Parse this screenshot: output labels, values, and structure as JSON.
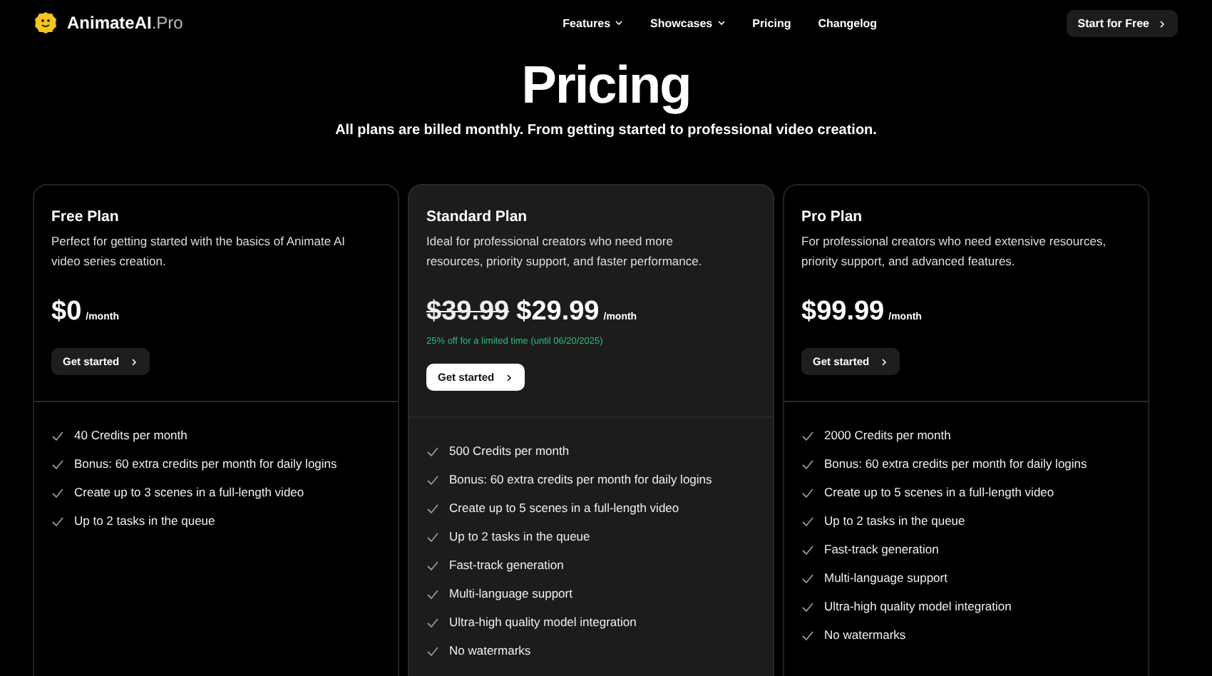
{
  "nav": {
    "logo": {
      "name": "AnimateAI",
      "suffix": ".Pro"
    },
    "links": [
      {
        "label": "Features",
        "dropdown": true
      },
      {
        "label": "Showcases",
        "dropdown": true
      },
      {
        "label": "Pricing",
        "dropdown": false
      },
      {
        "label": "Changelog",
        "dropdown": false
      }
    ],
    "cta": "Start for Free"
  },
  "heading": "Pricing",
  "subheading": "All plans are billed monthly. From getting started to professional video creation.",
  "plans": [
    {
      "name": "Free Plan",
      "description": "Perfect for getting started with the basics of Animate AI video series creation.",
      "highlighted": false,
      "price": "$0",
      "period": "/month",
      "button": "Get started",
      "features": [
        "40 Credits per month",
        "Bonus: 60 extra credits per month for daily logins",
        "Create up to 3 scenes in a full-length video",
        "Up to 2 tasks in the queue"
      ]
    },
    {
      "name": "Standard Plan",
      "description": "Ideal for professional creators who need more resources, priority support, and faster performance.",
      "highlighted": true,
      "old_price": "$39.99",
      "price": "$29.99",
      "period": "/month",
      "note": "25% off for a limited time (until 06/20/2025)",
      "button": "Get started",
      "features": [
        "500 Credits per month",
        "Bonus: 60 extra credits per month for daily logins",
        "Create up to 5 scenes in a full-length video",
        "Up to 2 tasks in the queue",
        "Fast-track generation",
        "Multi-language support",
        "Ultra-high quality model integration",
        "No watermarks"
      ]
    },
    {
      "name": "Pro Plan",
      "description": "For professional creators who need extensive resources, priority support, and advanced features.",
      "highlighted": false,
      "price": "$99.99",
      "period": "/month",
      "button": "Get started",
      "features": [
        "2000 Credits per month",
        "Bonus: 60 extra credits per month for daily logins",
        "Create up to 5 scenes in a full-length video",
        "Up to 2 tasks in the queue",
        "Fast-track generation",
        "Multi-language support",
        "Ultra-high quality model integration",
        "No watermarks"
      ]
    }
  ]
}
